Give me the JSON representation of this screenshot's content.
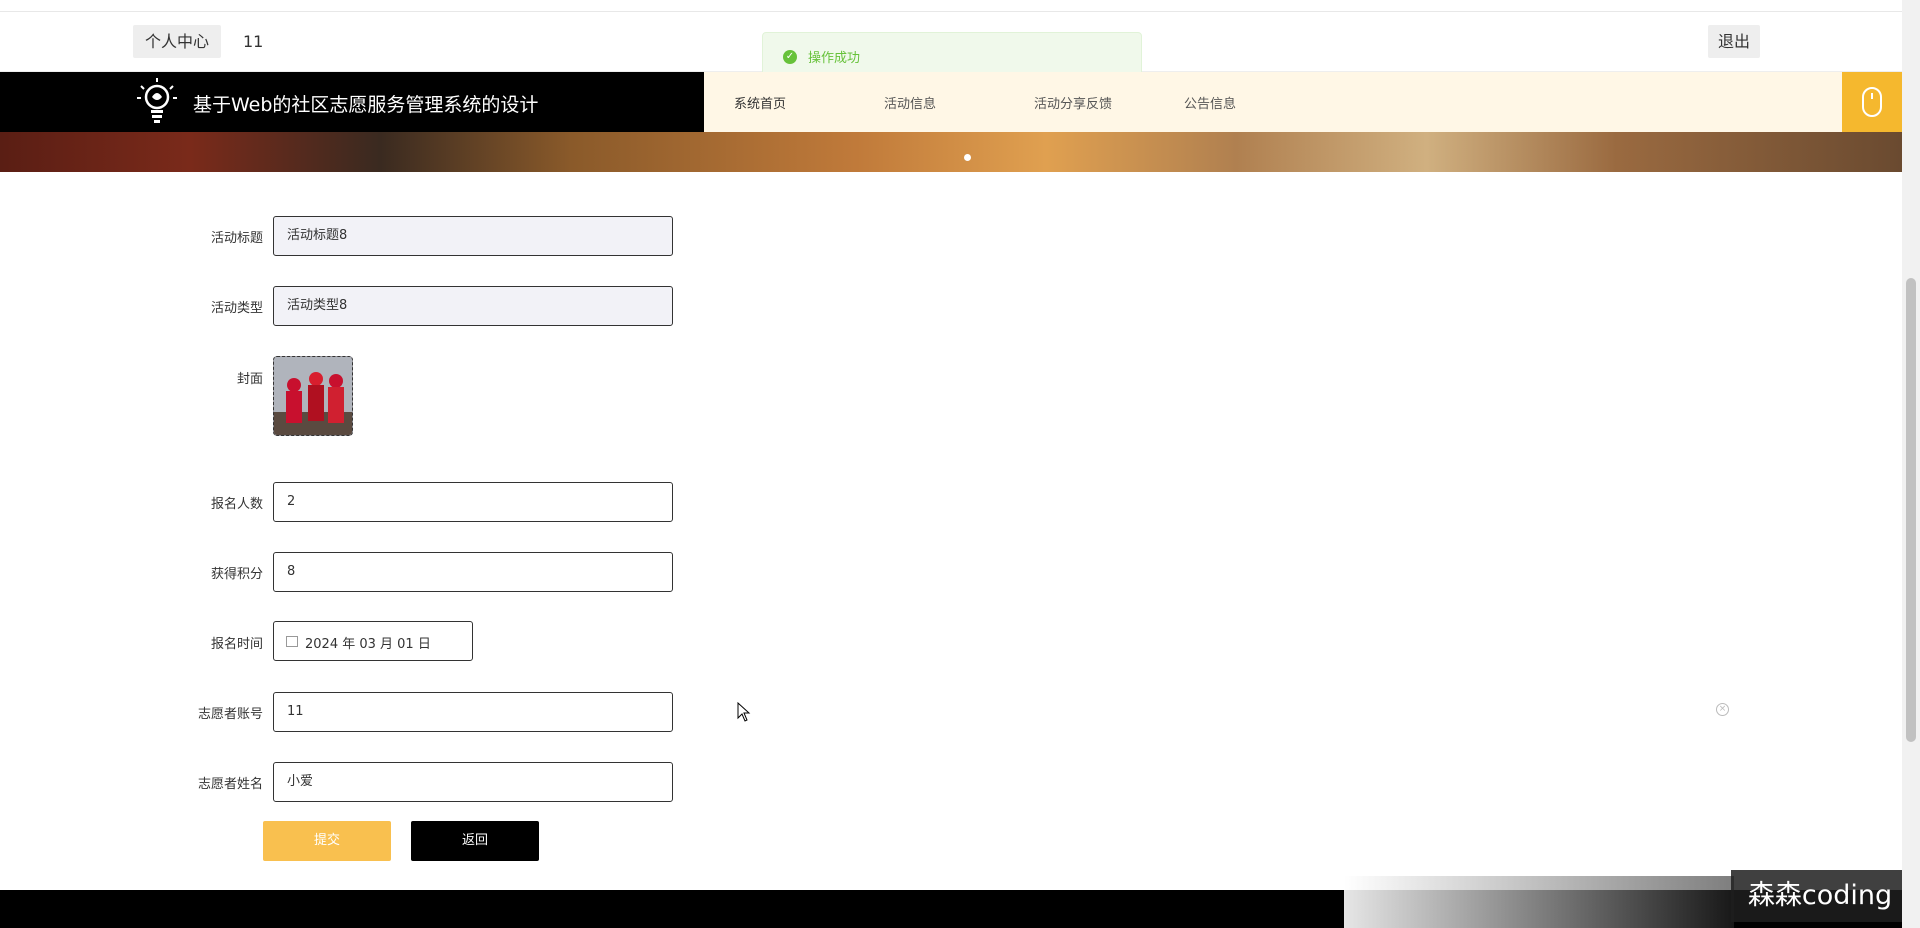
{
  "topbar": {
    "center_label": "个人中心",
    "user_id": "11",
    "logout_label": "退出"
  },
  "toast": {
    "message": "操作成功",
    "icon": "check-circle-icon",
    "color": "#67c23a"
  },
  "navbar": {
    "title": "基于Web的社区志愿服务管理系统的设计",
    "menu": [
      "系统首页",
      "活动信息",
      "活动分享反馈",
      "公告信息"
    ],
    "accent": "#f5b82e"
  },
  "form": {
    "title_label": "活动标题",
    "title_value": "活动标题8",
    "type_label": "活动类型",
    "type_value": "活动类型8",
    "cover_label": "封面",
    "signup_count_label": "报名人数",
    "signup_count_value": "2",
    "points_label": "获得积分",
    "points_value": "8",
    "signup_time_label": "报名时间",
    "signup_time_value": "2024 年 03 月 01 日",
    "account_label": "志愿者账号",
    "account_value": "11",
    "name_label": "志愿者姓名",
    "name_value": "小爱",
    "submit_label": "提交",
    "back_label": "返回"
  },
  "watermark": "森森coding"
}
